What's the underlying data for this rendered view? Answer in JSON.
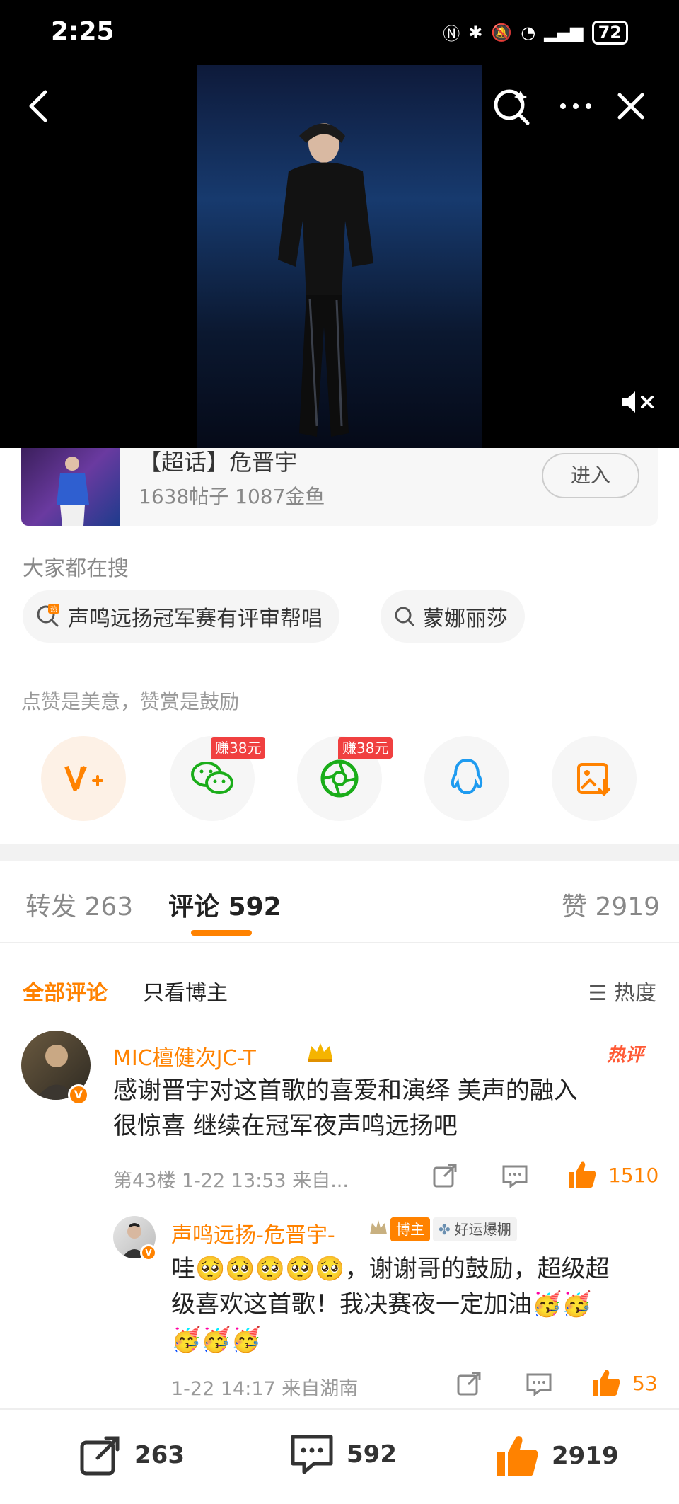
{
  "status_bar": {
    "time": "2:25",
    "battery": "72"
  },
  "topic": {
    "title": "【超话】危晋宇",
    "meta": "1638帖子 1087金鱼",
    "enter_label": "进入"
  },
  "search": {
    "label": "大家都在搜",
    "chips": [
      {
        "label": "声鸣远扬冠军赛有评审帮唱",
        "icon": "hot-search-icon"
      },
      {
        "label": "蒙娜丽莎",
        "icon": "search-icon"
      }
    ]
  },
  "reward": {
    "label": "点赞是美意，赞赏是鼓励",
    "earn_badge": "赚38元",
    "share_targets": [
      "v-plus",
      "wechat",
      "moments",
      "qq",
      "save-image"
    ]
  },
  "tabs": {
    "repost": "转发 263",
    "comments": "评论 592",
    "likes": "赞 2919"
  },
  "filters": {
    "all": "全部评论",
    "author_only": "只看博主",
    "sort": "热度"
  },
  "comment": {
    "name": "MIC檀健次JC-T",
    "hot_tag": "热评",
    "text_line1": "感谢晋宇对这首歌的喜爱和演绎 美声的融入",
    "text_line2": "很惊喜 继续在冠军夜声鸣远扬吧",
    "meta": "第43楼 1-22 13:53 来自...",
    "likes": "1510"
  },
  "reply": {
    "name": "声鸣远扬-危晋宇-",
    "role_badge": "博主",
    "fan_badge": "好运爆棚",
    "text_line1": "哇🥺🥺🥺🥺🥺，谢谢哥的鼓励，超级超",
    "text_line2": "级喜欢这首歌！我决赛夜一定加油🥳🥳",
    "text_line3": "🥳🥳🥳",
    "meta": "1-22 14:17 来自湖南",
    "likes": "53"
  },
  "bottom_bar": {
    "reposts": "263",
    "comments": "592",
    "likes": "2919"
  },
  "colors": {
    "accent": "#ff8200",
    "hot": "#ff5a36",
    "badge": "#f04040"
  }
}
